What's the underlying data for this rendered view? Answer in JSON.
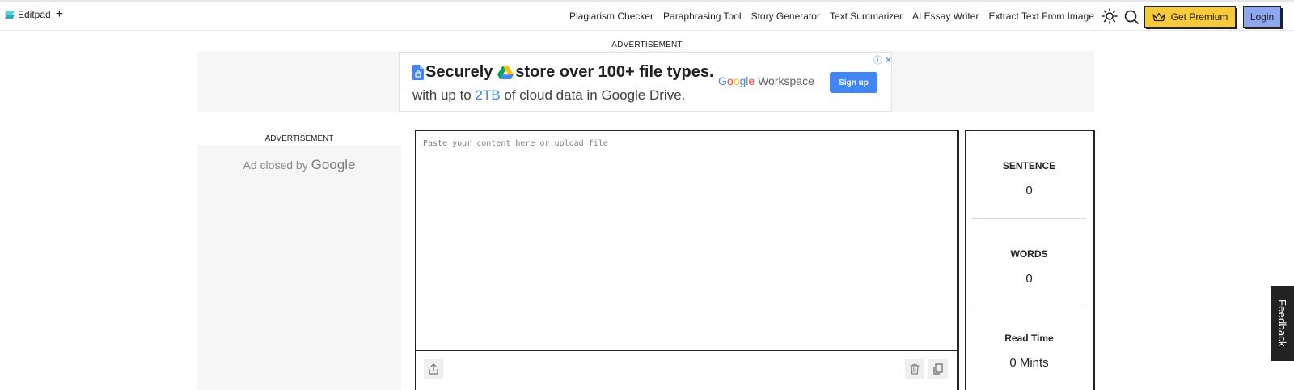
{
  "header": {
    "brand": "Editpad",
    "brand_plus": "+",
    "nav": [
      "Plagiarism Checker",
      "Paraphrasing Tool",
      "Story Generator",
      "Text Summarizer",
      "AI Essay Writer",
      "Extract Text From Image"
    ],
    "premium_label": "Get Premium",
    "login_label": "Login"
  },
  "ads": {
    "label": "ADVERTISEMENT",
    "top": {
      "headline_word": "Securely",
      "headline_rest": "store over 100+ file types.",
      "line2_before": "with up to ",
      "line2_highlight": "2TB",
      "line2_after": " of cloud data in Google Drive.",
      "brand_google": "Google",
      "brand_workspace": "Workspace",
      "cta": "Sign up",
      "choices": "ⓘ✕"
    },
    "left": {
      "closed_text": "Ad closed by",
      "closed_brand": "Google"
    }
  },
  "editor": {
    "placeholder": "Paste your content here or upload file",
    "value": ""
  },
  "stats": {
    "sentence_label": "SENTENCE",
    "sentence_value": "0",
    "words_label": "WORDS",
    "words_value": "0",
    "readtime_label": "Read Time",
    "readtime_value": "0 Mints"
  },
  "feedback_label": "Feedback",
  "colors": {
    "premium": "#f8c93b",
    "login": "#8ea6ef",
    "ad_cta": "#4285f4",
    "ad_background": "#f6f6f6"
  }
}
